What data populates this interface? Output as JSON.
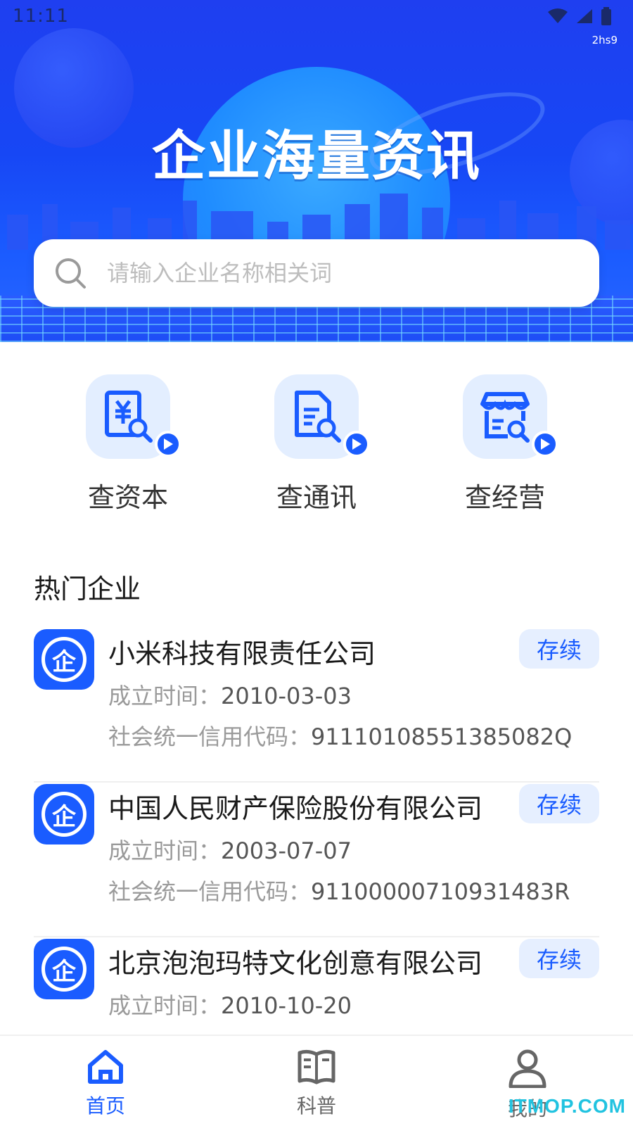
{
  "status_bar": {
    "time": "11:11",
    "sub_label": "2hs9"
  },
  "hero": {
    "title": "企业海量资讯"
  },
  "search": {
    "placeholder": "请输入企业名称相关词"
  },
  "quick_actions": [
    {
      "label": "查资本",
      "icon": "capital-search-icon"
    },
    {
      "label": "查通讯",
      "icon": "document-search-icon"
    },
    {
      "label": "查经营",
      "icon": "store-search-icon"
    }
  ],
  "hot_section": {
    "title": "热门企业"
  },
  "companies": [
    {
      "logo_char": "企",
      "name": "小米科技有限责任公司",
      "status": "存续",
      "founded_label": "成立时间：",
      "founded": "2010-03-03",
      "credit_label": "社会统一信用代码：",
      "credit_code": "91110108551385082Q"
    },
    {
      "logo_char": "企",
      "name": "中国人民财产保险股份有限公司",
      "status": "存续",
      "founded_label": "成立时间：",
      "founded": "2003-07-07",
      "credit_label": "社会统一信用代码：",
      "credit_code": "91100000710931483R"
    },
    {
      "logo_char": "企",
      "name": "北京泡泡玛特文化创意有限公司",
      "status": "存续",
      "founded_label": "成立时间：",
      "founded": "2010-10-20"
    }
  ],
  "bottom_nav": [
    {
      "label": "首页",
      "icon": "home-icon",
      "active": true
    },
    {
      "label": "科普",
      "icon": "book-icon",
      "active": false
    },
    {
      "label": "我的",
      "icon": "user-icon",
      "active": false
    }
  ],
  "watermark": "ITMOP.COM",
  "colors": {
    "primary": "#1a5cff",
    "tile_bg": "#e3eeff",
    "badge_bg": "#e6efff"
  }
}
